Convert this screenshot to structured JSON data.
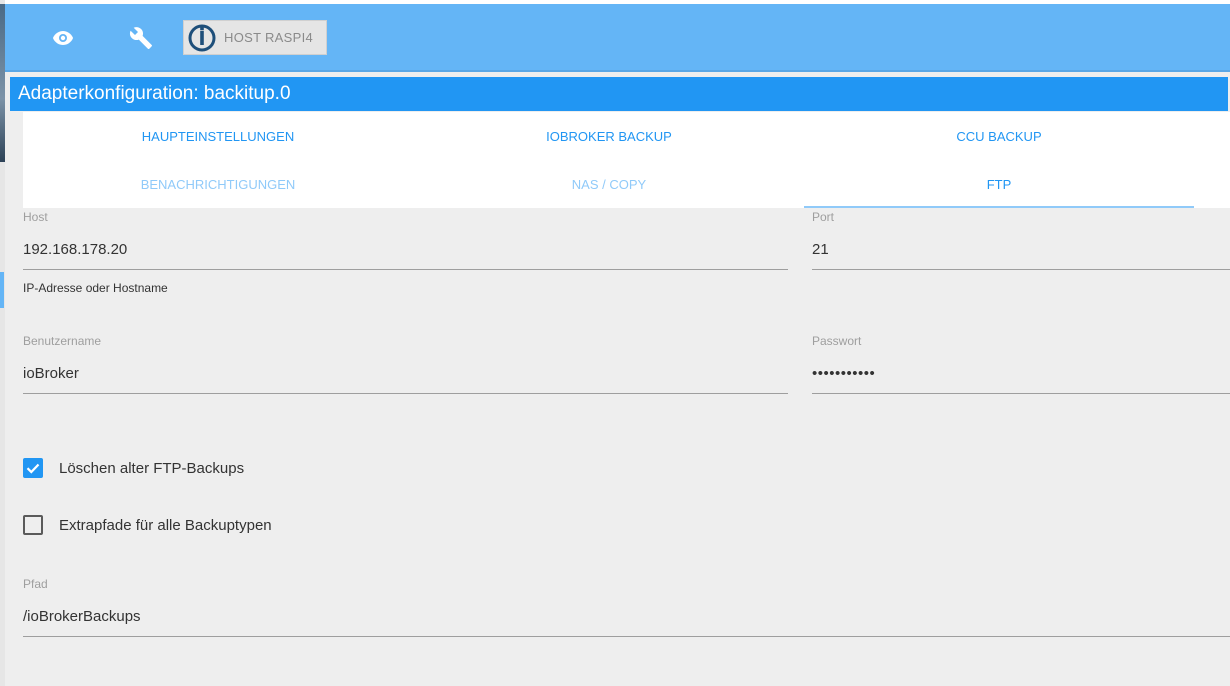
{
  "host_button": {
    "label": "HOST RASPI4"
  },
  "page_title": "Adapterkonfiguration: backitup.0",
  "tabs": [
    {
      "label": "HAUPTEINSTELLUNGEN"
    },
    {
      "label": "IOBROKER BACKUP"
    },
    {
      "label": "CCU BACKUP"
    },
    {
      "label": "BENACHRICHTIGUNGEN"
    },
    {
      "label": "NAS / COPY"
    },
    {
      "label": "FTP"
    }
  ],
  "form": {
    "host": {
      "label": "Host",
      "value": "192.168.178.20",
      "helper": "IP-Adresse oder Hostname"
    },
    "port": {
      "label": "Port",
      "value": "21"
    },
    "username": {
      "label": "Benutzername",
      "value": "ioBroker"
    },
    "password": {
      "label": "Passwort",
      "value": "•••••••••••"
    },
    "delete_old": {
      "label": "Löschen alter FTP-Backups",
      "checked": true
    },
    "extra_paths": {
      "label": "Extrapfade für alle Backuptypen",
      "checked": false
    },
    "path": {
      "label": "Pfad",
      "value": "/ioBrokerBackups"
    }
  },
  "colors": {
    "toolbar": "#64b5f6",
    "title_bar": "#2196f3",
    "active_tab": "#2196f3",
    "inactive_tab": "#90caf9",
    "content_bg": "#eeeeee"
  }
}
